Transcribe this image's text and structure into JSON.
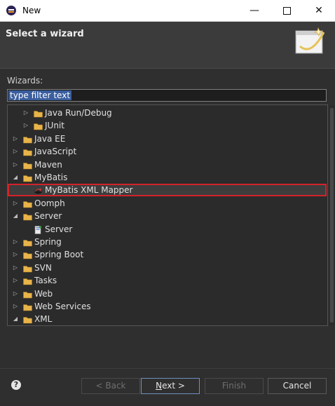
{
  "window": {
    "title": "New",
    "controls": {
      "minimize": "—",
      "close": "✕"
    }
  },
  "header": {
    "heading": "Select a wizard"
  },
  "wizards": {
    "label": "Wizards:",
    "filter_placeholder": "type filter text"
  },
  "tree": [
    {
      "label": "Java Run/Debug",
      "depth": 1,
      "expanded": false,
      "kind": "folder"
    },
    {
      "label": "JUnit",
      "depth": 1,
      "expanded": false,
      "kind": "folder"
    },
    {
      "label": "Java EE",
      "depth": 0,
      "expanded": false,
      "kind": "folder"
    },
    {
      "label": "JavaScript",
      "depth": 0,
      "expanded": false,
      "kind": "folder"
    },
    {
      "label": "Maven",
      "depth": 0,
      "expanded": false,
      "kind": "folder"
    },
    {
      "label": "MyBatis",
      "depth": 0,
      "expanded": true,
      "kind": "folder"
    },
    {
      "label": "MyBatis XML Mapper",
      "depth": 1,
      "kind": "mybatis",
      "selected": true
    },
    {
      "label": "Oomph",
      "depth": 0,
      "expanded": false,
      "kind": "folder"
    },
    {
      "label": "Server",
      "depth": 0,
      "expanded": true,
      "kind": "folder"
    },
    {
      "label": "Server",
      "depth": 1,
      "kind": "server"
    },
    {
      "label": "Spring",
      "depth": 0,
      "expanded": false,
      "kind": "folder"
    },
    {
      "label": "Spring Boot",
      "depth": 0,
      "expanded": false,
      "kind": "folder"
    },
    {
      "label": "SVN",
      "depth": 0,
      "expanded": false,
      "kind": "folder"
    },
    {
      "label": "Tasks",
      "depth": 0,
      "expanded": false,
      "kind": "folder"
    },
    {
      "label": "Web",
      "depth": 0,
      "expanded": false,
      "kind": "folder"
    },
    {
      "label": "Web Services",
      "depth": 0,
      "expanded": false,
      "kind": "folder"
    },
    {
      "label": "XML",
      "depth": 0,
      "expanded": true,
      "kind": "folder"
    }
  ],
  "buttons": {
    "help": "?",
    "back": "< Back",
    "next_mnemonic": "N",
    "next_rest": "ext >",
    "finish": "Finish",
    "cancel": "Cancel"
  },
  "colors": {
    "dialog_bg": "#2f2f2f",
    "folder": "#e8b44a",
    "selection_border": "#d2232a",
    "filter_highlight": "#3a5e9e"
  }
}
